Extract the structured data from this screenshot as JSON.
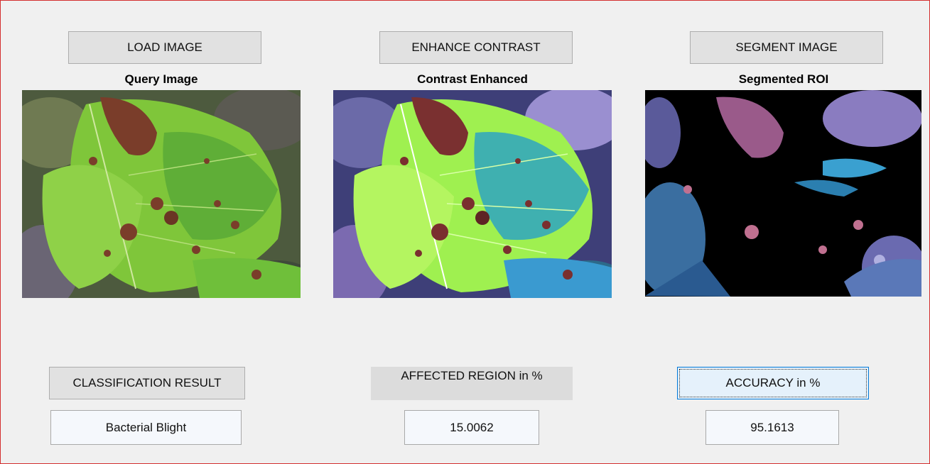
{
  "buttons": {
    "load": "LOAD IMAGE",
    "enhance": "ENHANCE CONTRAST",
    "segment": "SEGMENT IMAGE",
    "classification": "CLASSIFICATION RESULT",
    "affected": "AFFECTED REGION in %",
    "accuracy": "ACCURACY in %"
  },
  "panels": {
    "query": "Query Image",
    "enhanced": "Contrast Enhanced",
    "segmented": "Segmented ROI"
  },
  "results": {
    "classification": "Bacterial Blight",
    "affected_region": "15.0062",
    "accuracy": "95.1613"
  },
  "colors": {
    "window_border": "#d32f2f",
    "focus_border": "#0078d7",
    "leaf_green": "#7fc63a",
    "lesion_brown": "#7a3d2a"
  }
}
